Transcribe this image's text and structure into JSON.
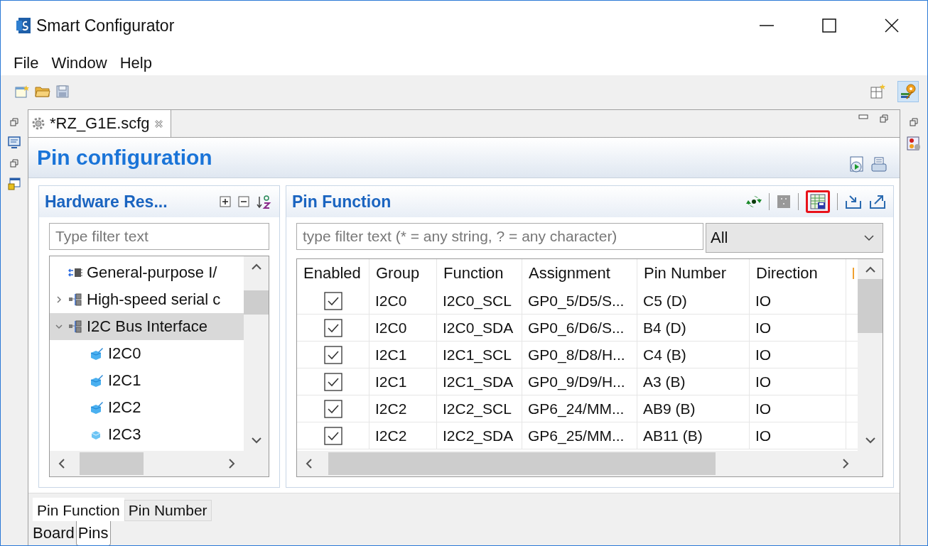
{
  "window": {
    "title": "Smart Configurator"
  },
  "menu": [
    "File",
    "Window",
    "Help"
  ],
  "editor_tab": {
    "label": "*RZ_G1E.scfg",
    "selected": true
  },
  "page_title": "Pin configuration",
  "hardware_panel": {
    "title": "Hardware Res...",
    "filter": {
      "placeholder": "Type filter text"
    },
    "tree": [
      {
        "label": "General-purpose I/",
        "kind": "gpio",
        "selected": false
      },
      {
        "label": "High-speed serial c",
        "kind": "module",
        "expanded": false,
        "selected": false
      },
      {
        "label": "I2C Bus Interface",
        "kind": "module",
        "expanded": true,
        "selected": true,
        "children": [
          {
            "label": "I2C0",
            "kind": "configured"
          },
          {
            "label": "I2C1",
            "kind": "configured"
          },
          {
            "label": "I2C2",
            "kind": "configured"
          },
          {
            "label": "I2C3",
            "kind": "unconfigured"
          }
        ]
      }
    ]
  },
  "function_panel": {
    "title": "Pin Function",
    "filter": {
      "placeholder": "type filter text (* = any string, ? = any character)"
    },
    "dropdown": "All",
    "columns": [
      "Enabled",
      "Group",
      "Function",
      "Assignment",
      "Pin Number",
      "Direction"
    ],
    "rows": [
      {
        "enabled": true,
        "cells": [
          "",
          "I2C0",
          "I2C0_SCL",
          "GP0_5/D5/S...",
          "C5 (D)",
          "IO"
        ]
      },
      {
        "enabled": true,
        "cells": [
          "",
          "I2C0",
          "I2C0_SDA",
          "GP0_6/D6/S...",
          "B4 (D)",
          "IO"
        ]
      },
      {
        "enabled": true,
        "cells": [
          "",
          "I2C1",
          "I2C1_SCL",
          "GP0_8/D8/H...",
          "C4 (B)",
          "IO"
        ]
      },
      {
        "enabled": true,
        "cells": [
          "",
          "I2C1",
          "I2C1_SDA",
          "GP0_9/D9/H...",
          "A3 (B)",
          "IO"
        ]
      },
      {
        "enabled": true,
        "cells": [
          "",
          "I2C2",
          "I2C2_SCL",
          "GP6_24/MM...",
          "AB9 (B)",
          "IO"
        ]
      },
      {
        "enabled": true,
        "cells": [
          "",
          "I2C2",
          "I2C2_SDA",
          "GP6_25/MM...",
          "AB11 (B)",
          "IO"
        ]
      }
    ]
  },
  "view_tabs": [
    {
      "label": "Pin Function",
      "selected": true
    },
    {
      "label": "Pin Number",
      "selected": false
    }
  ],
  "page_tabs": [
    {
      "label": "Board",
      "selected": false
    },
    {
      "label": "Pins",
      "selected": true
    }
  ]
}
